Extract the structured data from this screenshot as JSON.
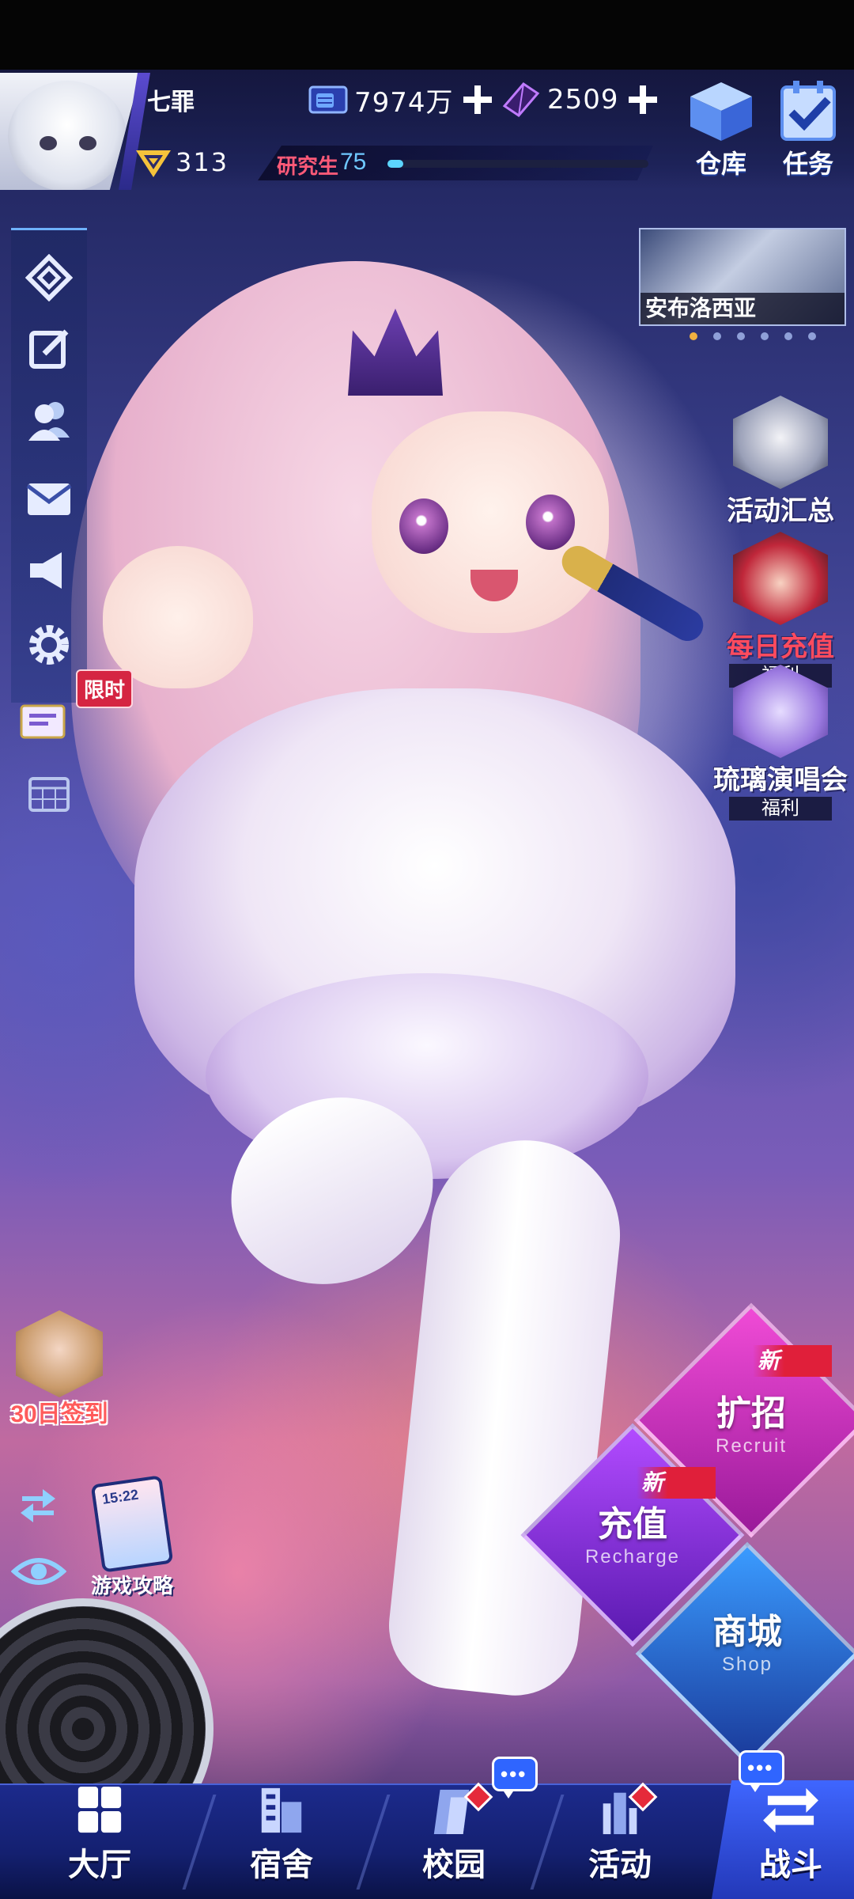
{
  "player": {
    "name": "七罪",
    "level": "313",
    "rank_title": "研究生",
    "rank_level": "75",
    "exp_percent": 6
  },
  "resources": {
    "coins": "7974万",
    "gems": "2509"
  },
  "top_buttons": {
    "warehouse": "仓库",
    "tasks": "任务"
  },
  "sidebar": {
    "limited_tag": "限时",
    "icons": [
      "home-diamond-icon",
      "edit-icon",
      "friends-icon",
      "mail-icon",
      "announcement-icon",
      "settings-icon",
      "limited-mail-icon",
      "calendar-icon"
    ]
  },
  "banner": {
    "label": "安布洛西亚",
    "dots": 6,
    "active_dot": 0
  },
  "events": {
    "summary": "活动汇总",
    "daily_recharge": "每日充值",
    "daily_recharge_sub": "福利",
    "concert": "琉璃演唱会",
    "concert_sub": "福利"
  },
  "left_bottom": {
    "signin": "30日签到",
    "guide": "游戏攻略",
    "phone_time": "15:22"
  },
  "actions": {
    "recruit_cn": "扩招",
    "recruit_en": "Recruit",
    "recharge_cn": "充值",
    "recharge_en": "Recharge",
    "shop_cn": "商城",
    "shop_en": "Shop",
    "new_tag": "新"
  },
  "nav": {
    "hall": "大厅",
    "dorm": "宿舍",
    "campus": "校园",
    "activity": "活动",
    "battle": "战斗"
  },
  "colors": {
    "recruit": "#c21fb4",
    "recharge": "#8a2bd6",
    "shop": "#1f5fc8",
    "nav_bg": "#1c2a8c",
    "new_tag": "#e01f3a",
    "rank_title": "#ff5a78",
    "exp_fill": "#5cd5ff"
  }
}
